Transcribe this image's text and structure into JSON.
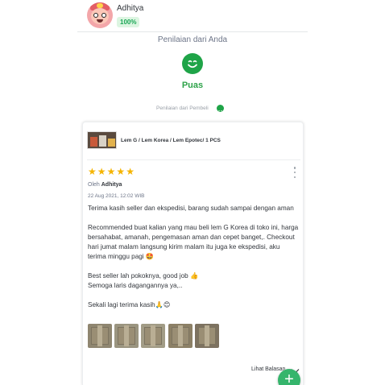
{
  "user": {
    "name": "Adhitya",
    "badge": "100%",
    "avatar_icon": "cartoon-avatar-icon"
  },
  "rating": {
    "title": "Penilaian dari Anda",
    "label": "Puas",
    "icon": "happy-face-icon",
    "icon_color": "#1fa448",
    "buyer_caption": "Penilaian dari Pembeli"
  },
  "product": {
    "name": "Lem G / Lem Korea / Lem Epotec/ 1 PCS"
  },
  "review": {
    "stars": 5,
    "star_color": "#f5b400",
    "by_prefix": "Oleh",
    "author": "Adhitya",
    "date": "22 Aug 2021, 12:02 WIB",
    "text": "Terima kasih seller dan ekspedisi, barang sudah sampai dengan aman\n\nRecommended buat kalian yang mau beli lem G Korea di toko ini, harga bersahabat, amanah, pengemasan aman dan cepet banget,. Checkout hari jumat malam langsung kirim malam itu juga ke ekspedisi, aku terima minggu pagi 🤩\n\nBest seller lah pokoknya, good job 👍\nSemoga laris dagangannya ya,..\n\nSekali lagi terima kasih🙏😊",
    "photo_count": 5,
    "reply_label": "Lihat Balasan"
  },
  "fab": {
    "label": "+",
    "color": "#35b56c"
  }
}
